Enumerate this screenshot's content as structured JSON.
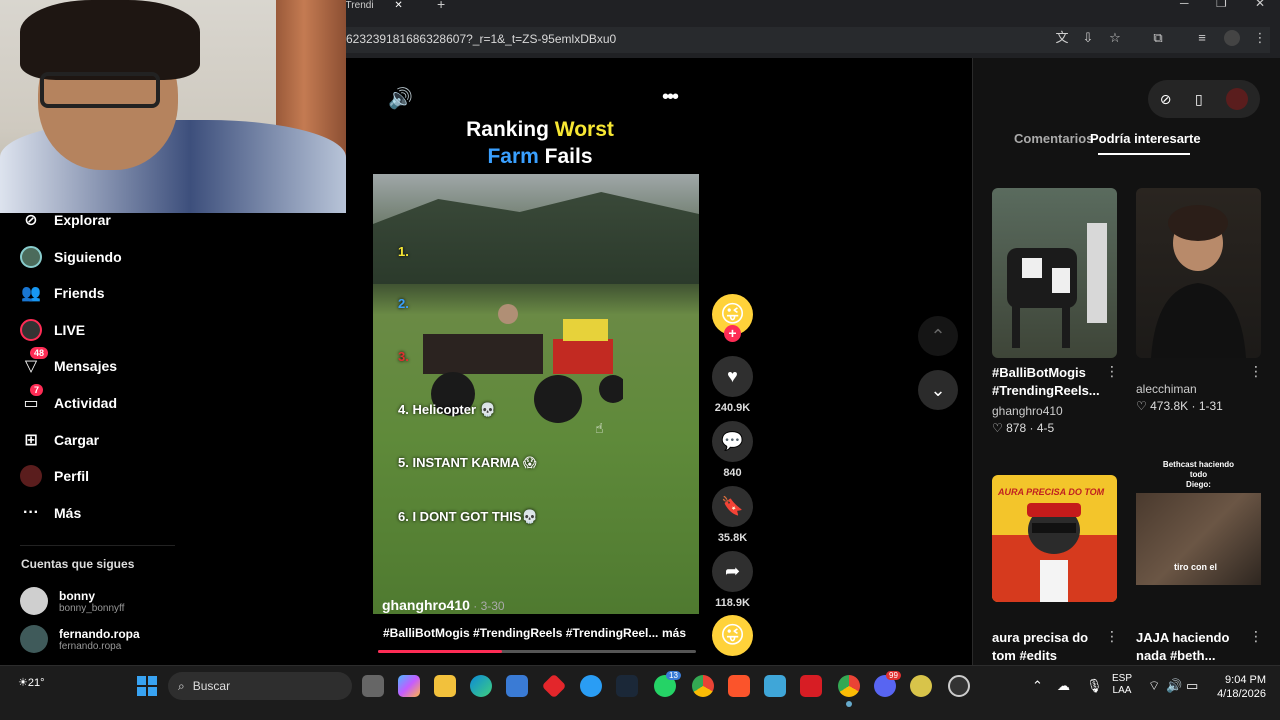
{
  "browser": {
    "tab_title": "#Trendi",
    "url": "623239181686328607?_r=1&_t=ZS-95emlxDBxu0"
  },
  "sidebar": {
    "items": [
      {
        "label": "Explorar",
        "icon": "compass-icon"
      },
      {
        "label": "Siguiendo",
        "icon": "following-avatar-icon"
      },
      {
        "label": "Friends",
        "icon": "friends-icon"
      },
      {
        "label": "LIVE",
        "icon": "live-icon"
      },
      {
        "label": "Mensajes",
        "icon": "messages-icon",
        "badge": "48"
      },
      {
        "label": "Actividad",
        "icon": "activity-icon",
        "badge": "7"
      },
      {
        "label": "Cargar",
        "icon": "upload-icon"
      },
      {
        "label": "Perfil",
        "icon": "profile-icon"
      },
      {
        "label": "Más",
        "icon": "more-icon"
      }
    ],
    "following_title": "Cuentas que sigues",
    "accounts": [
      {
        "name": "bonny",
        "handle": "bonny_bonnyff"
      },
      {
        "name": "fernando.ropa",
        "handle": "fernando.ropa"
      }
    ]
  },
  "video": {
    "title_line1_a": "Ranking ",
    "title_line1_b": "Worst",
    "title_line2_a": "Farm",
    "title_line2_b": " Fails",
    "rankings": [
      "1.",
      "2.",
      "3.",
      "4. Helicopter 💀",
      "5. INSTANT KARMA 😱",
      "6. I DONT GOT THIS💀"
    ],
    "author": "ghanghro410",
    "date": " · 3-30",
    "caption": "#BalliBotMogis #TrendingReels #TrendingReel...",
    "more": "más",
    "progress": 0.39
  },
  "actions": {
    "likes": "240.9K",
    "comments": "840",
    "saves": "35.8K",
    "shares": "118.9K"
  },
  "right_panel": {
    "tab_comments": "Comentarios",
    "tab_interest": "Podría interesarte",
    "cards": [
      {
        "title": "#BalliBotMogis #TrendingReels...",
        "author": "ghanghro410",
        "likes": "878",
        "date": "4-5"
      },
      {
        "title": "",
        "author": "alecchiman",
        "likes": "473.8K",
        "date": "1-31"
      },
      {
        "title": "aura precisa do tom #edits #aura...",
        "author": "",
        "likes": "",
        "date": "",
        "thumb_text": "AURA PRECISA DO TOM"
      },
      {
        "title": "JAJA haciendo nada #beth...",
        "author": "",
        "likes": "",
        "date": "",
        "thumb_text_top": "Bethcast haciendo todo\nDiego:",
        "thumb_text_mid": "tiro con el"
      }
    ]
  },
  "taskbar": {
    "weather": "21°",
    "search": "Buscar",
    "lang_1": "ESP",
    "lang_2": "LAA",
    "time": "9:04 PM",
    "date": "4/18/2026",
    "badge_whatsapp": "13",
    "badge_discord": "99"
  }
}
